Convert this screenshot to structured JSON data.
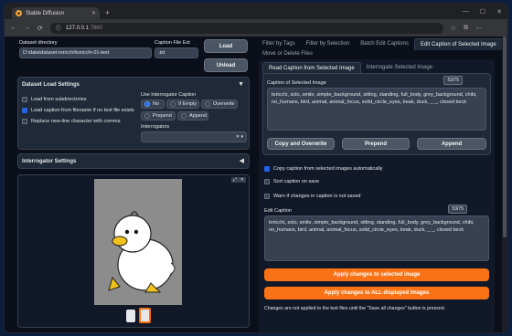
{
  "browser": {
    "tab_title": "Stable Diffusion",
    "url_host": "127.0.0.1",
    "url_port": ":7860",
    "new_tab": "+",
    "window_controls": [
      "—",
      "☐",
      "✕"
    ]
  },
  "left": {
    "dataset_dir_label": "Dataset directory",
    "dataset_dir_value": "D:\\data\\dataset-toricchi\\toricchi-01-test",
    "caption_ext_label": "Caption File Ext",
    "caption_ext_value": ".txt",
    "load_button": "Load",
    "unload_button": "Unload",
    "load_settings_title": "Dataset Load Settings",
    "opt_subdirs": "Load from subdirectories",
    "opt_filename": "Load caption from filename if no text file exists",
    "opt_comma": "Replace new-line character with comma",
    "use_interrogator_label": "Use Interrogator Caption",
    "radio_no": "No",
    "radio_empty": "If Empty",
    "radio_overwrite": "Overwrite",
    "radio_prepend": "Prepend",
    "radio_append": "Append",
    "interrogators_label": "Interrogators",
    "interrogator_settings": "Interrogator Settings",
    "gallery_controls": [
      "⤢",
      "✕"
    ]
  },
  "right": {
    "tabs": [
      "Filter by Tags",
      "Filter by Selection",
      "Batch Edit Captions",
      "Edit Caption of Selected Image"
    ],
    "tab2": "Move or Delete Files",
    "subtabs": [
      "Read Caption from Selected Image",
      "Interrogate Selected Image"
    ],
    "caption_label": "Caption of Selected Image",
    "caption_count": "53/75",
    "caption_text": "toricchi, solo, smile, simple_background, sitting, standing, full_body, grey_background, chibi, no_humans, bird, animal, animal_focus, solid_circle_eyes, beak, duck, _ _, closed beck",
    "copy_overwrite": "Copy and Overwrite",
    "prepend": "Prepend",
    "append": "Append",
    "opt_copy_auto": "Copy caption from selected images automatically",
    "opt_sort": "Sort caption on save",
    "opt_warn": "Warn if changes in caption is not saved",
    "edit_caption_label": "Edit Caption",
    "edit_count": "53/75",
    "edit_text": "toricchi, solo, smile, simple_background, sitting, standing, full_body, grey_background, chibi, no_humans, bird, animal, animal_focus, solid_circle_eyes, beak, duck, _ _, closed beck",
    "apply_selected": "Apply changes to selected image",
    "apply_all": "Apply changes to ALL displayed images",
    "note": "Changes are not applied to the text files until the \"Save all changes\" button is pressed."
  },
  "colors": {
    "accent": "#f97316",
    "panel": "#1f2937",
    "bg": "#0b0f19"
  }
}
